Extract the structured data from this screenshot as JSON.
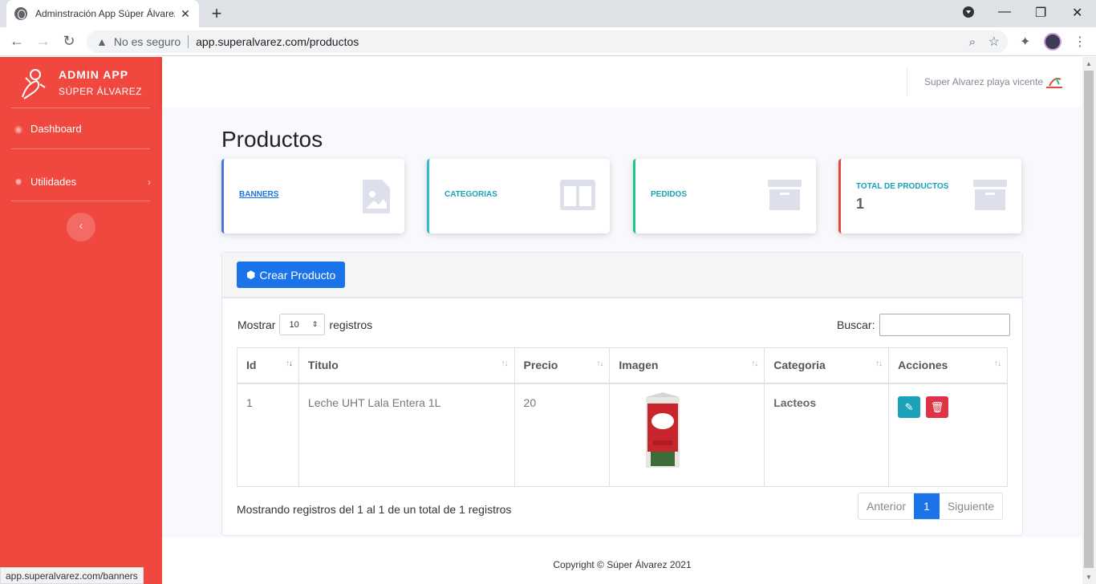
{
  "browser": {
    "tab_title": "Adminstración App Súper Álvarez",
    "new_tab": "+",
    "insecure_label": "No es seguro",
    "url": "app.superalvarez.com/productos",
    "status_url": "app.superalvarez.com/banners",
    "min": "—",
    "max": "❐",
    "close": "✕"
  },
  "sidebar": {
    "brand_line1": "ADMIN APP",
    "brand_line2": "SÚPER ÁLVAREZ",
    "items": [
      {
        "label": "Dashboard",
        "icon": "dashboard-icon"
      },
      {
        "label": "Utilidades",
        "icon": "gear-icon"
      }
    ]
  },
  "topbar": {
    "user_name": "Super Alvarez playa vicente"
  },
  "page": {
    "title": "Productos"
  },
  "cards": [
    {
      "label": "BANNERS",
      "icon": "image-icon",
      "accent": "#4e73df"
    },
    {
      "label": "CATEGORIAS",
      "icon": "columns-icon",
      "accent": "#36b9cc"
    },
    {
      "label": "PEDIDOS",
      "icon": "archive-icon",
      "accent": "#1cc88a"
    },
    {
      "label": "TOTAL DE PRODUCTOS",
      "value": "1",
      "icon": "archive-icon",
      "accent": "#e74a3b"
    }
  ],
  "panel": {
    "create_button": "Crear Producto",
    "length_prefix": "Mostrar",
    "length_value": "10",
    "length_suffix": "registros",
    "search_label": "Buscar:",
    "columns": [
      "Id",
      "Titulo",
      "Precio",
      "Imagen",
      "Categoria",
      "Acciones"
    ],
    "rows": [
      {
        "id": "1",
        "titulo": "Leche UHT Lala Entera 1L",
        "precio": "20",
        "categoria": "Lacteos"
      }
    ],
    "info": "Mostrando registros del 1 al 1 de un total de 1 registros",
    "pager": {
      "prev": "Anterior",
      "current": "1",
      "next": "Siguiente"
    }
  },
  "footer": {
    "text": "Copyright © Súper Álvarez 2021"
  },
  "colors": {
    "sidebar": "#f0473e",
    "primary": "#1a73e8"
  }
}
